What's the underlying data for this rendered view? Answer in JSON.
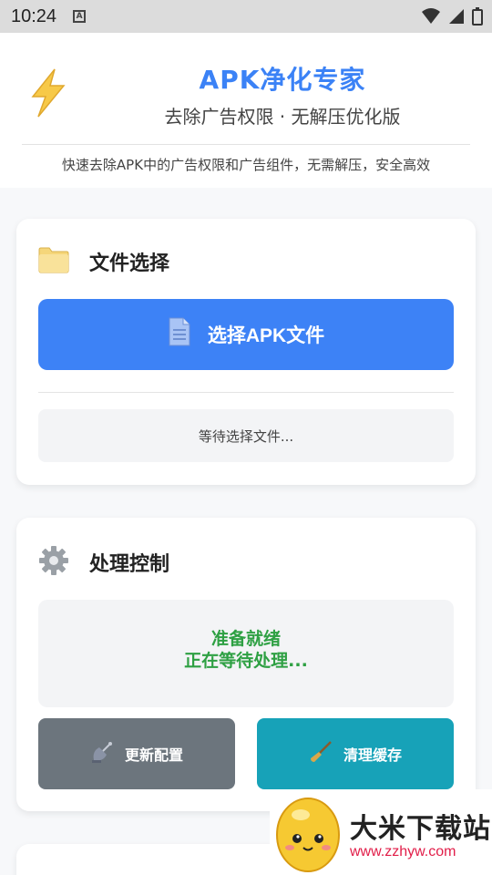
{
  "status_bar": {
    "time": "10:24",
    "indicator": "A"
  },
  "header": {
    "title": "APK净化专家",
    "subtitle": "去除广告权限 · 无解压优化版",
    "description": "快速去除APK中的广告权限和广告组件，无需解压，安全高效",
    "icon": "lightning-icon"
  },
  "file_card": {
    "title": "文件选择",
    "icon": "folder-icon",
    "select_button": "选择APK文件",
    "select_icon": "document-icon",
    "status_text": "等待选择文件..."
  },
  "control_card": {
    "title": "处理控制",
    "icon": "gear-icon",
    "status_line1": "准备就绪",
    "status_line2": "正在等待处理...",
    "update_button": "更新配置",
    "update_icon": "satellite-icon",
    "clear_button": "清理缓存",
    "clear_icon": "broom-icon"
  },
  "watermark": {
    "name": "大米下载站",
    "url": "www.zzhyw.com"
  },
  "colors": {
    "primary": "#3d82f6",
    "success": "#2ea043",
    "gray_button": "#6c757d",
    "teal_button": "#17a2b8",
    "title_blue": "#3b82f6"
  }
}
